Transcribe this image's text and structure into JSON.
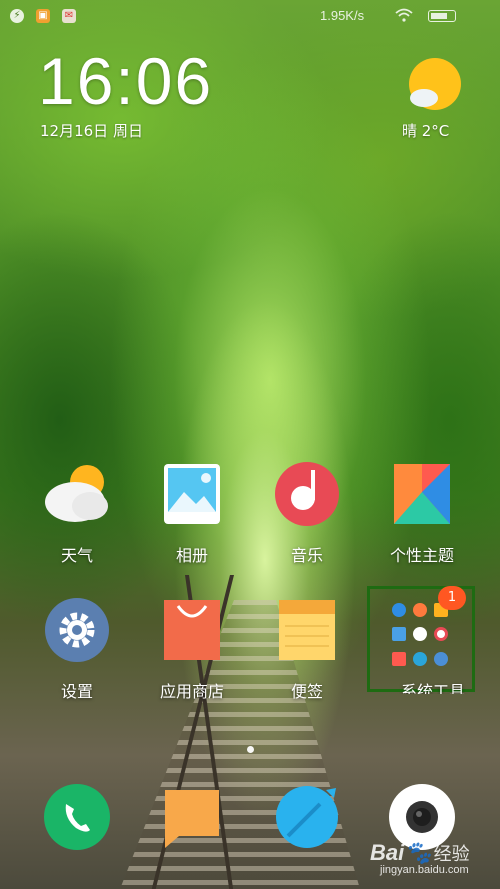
{
  "status_bar": {
    "net_speed": "1.95K/s",
    "icons": [
      "flash-icon",
      "notification-app-icon",
      "notification-app-icon-2",
      "wifi-icon",
      "battery-icon"
    ]
  },
  "clock_widget": {
    "time": "16:06",
    "date": "12月16日 周日"
  },
  "weather_widget": {
    "icon": "partly-cloudy-icon",
    "condition_temp": "晴 2°C"
  },
  "apps": [
    {
      "label": "天气",
      "icon": "weather-icon"
    },
    {
      "label": "相册",
      "icon": "gallery-icon"
    },
    {
      "label": "音乐",
      "icon": "music-icon"
    },
    {
      "label": "个性主题",
      "icon": "themes-icon"
    },
    {
      "label": "设置",
      "icon": "settings-gear-icon"
    },
    {
      "label": "应用商店",
      "icon": "app-store-bag-icon"
    },
    {
      "label": "便签",
      "icon": "notes-icon"
    }
  ],
  "folder": {
    "label": "系统工具",
    "badge": "1",
    "highlight_color": "#1e6b12"
  },
  "dock": [
    {
      "icon": "phone-icon"
    },
    {
      "icon": "messages-icon"
    },
    {
      "icon": "browser-icon"
    },
    {
      "icon": "camera-icon"
    }
  ],
  "watermark": {
    "brand": "Bai",
    "text": "经验",
    "url": "jingyan.baidu.com"
  },
  "colors": {
    "badge": "#ff5722",
    "music": "#e84a55",
    "app_store": "#f26b4a",
    "settings": "#5b7fb0",
    "phone": "#1ab567",
    "messages": "#f8a84a",
    "browser": "#29b2ee"
  }
}
